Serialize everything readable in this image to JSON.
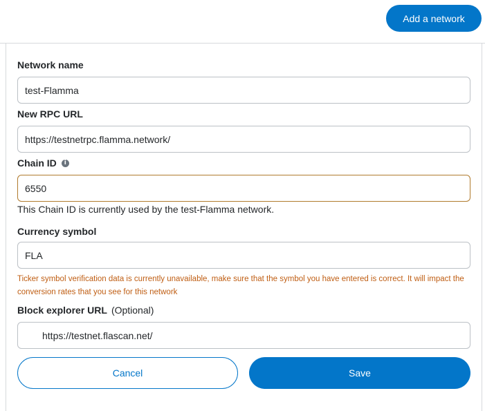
{
  "header": {
    "add_network_label": "Add a network"
  },
  "form": {
    "network_name": {
      "label": "Network name",
      "value": "test-Flamma"
    },
    "rpc_url": {
      "label": "New RPC URL",
      "value": "https://testnetrpc.flamma.network/"
    },
    "chain_id": {
      "label": "Chain ID",
      "info_icon": "i",
      "value": "6550",
      "helper": "This Chain ID is currently used by the test-Flamma network."
    },
    "currency_symbol": {
      "label": "Currency symbol",
      "value": "FLA",
      "warning": "Ticker symbol verification data is currently unavailable, make sure that the symbol you have entered is correct. It will impact the conversion rates that you see for this network"
    },
    "block_explorer": {
      "label": "Block explorer URL",
      "optional": "(Optional)",
      "value": "https://testnet.flascan.net/"
    }
  },
  "actions": {
    "cancel_label": "Cancel",
    "save_label": "Save"
  },
  "colors": {
    "primary": "#0376c9",
    "warning": "#bf5d12",
    "warning_border": "#b07a2c",
    "border": "#bbc0c5"
  }
}
